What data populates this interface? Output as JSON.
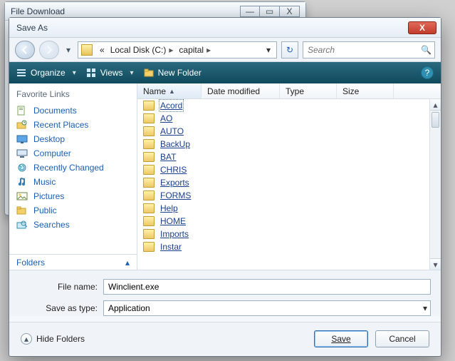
{
  "back_window": {
    "title": "File Download"
  },
  "dialog": {
    "title": "Save As"
  },
  "breadcrumb": {
    "prefix": "«",
    "segments": [
      "Local Disk (C:)",
      "capital"
    ],
    "dropdown_glyph": "▾"
  },
  "search": {
    "placeholder": "Search"
  },
  "toolbar": {
    "organize": "Organize",
    "views": "Views",
    "new_folder": "New Folder"
  },
  "sidebar": {
    "header": "Favorite Links",
    "items": [
      {
        "label": "Documents",
        "icon": "documents-icon"
      },
      {
        "label": "Recent Places",
        "icon": "recent-icon"
      },
      {
        "label": "Desktop",
        "icon": "desktop-icon"
      },
      {
        "label": "Computer",
        "icon": "computer-icon"
      },
      {
        "label": "Recently Changed",
        "icon": "recently-changed-icon"
      },
      {
        "label": "Music",
        "icon": "music-icon"
      },
      {
        "label": "Pictures",
        "icon": "pictures-icon"
      },
      {
        "label": "Public",
        "icon": "public-folder-icon"
      },
      {
        "label": "Searches",
        "icon": "searches-icon"
      }
    ],
    "folders_label": "Folders"
  },
  "columns": {
    "name": "Name",
    "date": "Date modified",
    "type": "Type",
    "size": "Size"
  },
  "files": [
    {
      "name": "Acord",
      "selected": true
    },
    {
      "name": "AO"
    },
    {
      "name": "AUTO"
    },
    {
      "name": "BackUp"
    },
    {
      "name": "BAT"
    },
    {
      "name": "CHRIS"
    },
    {
      "name": "Exports"
    },
    {
      "name": "FORMS"
    },
    {
      "name": "Help"
    },
    {
      "name": "HOME"
    },
    {
      "name": "Imports"
    },
    {
      "name": "Instar"
    }
  ],
  "form": {
    "filename_label": "File name:",
    "filename_value": "Winclient.exe",
    "type_label": "Save as type:",
    "type_value": "Application"
  },
  "footer": {
    "hide_label": "Hide Folders",
    "save_label": "Save",
    "cancel_label": "Cancel"
  },
  "glyphs": {
    "min": "—",
    "max": "▭",
    "close": "X",
    "back": "←",
    "fwd": "→",
    "chev_down": "▾",
    "chev_up": "▴",
    "refresh": "↻",
    "search": "🔍",
    "help": "?",
    "sort_up": "▲"
  }
}
